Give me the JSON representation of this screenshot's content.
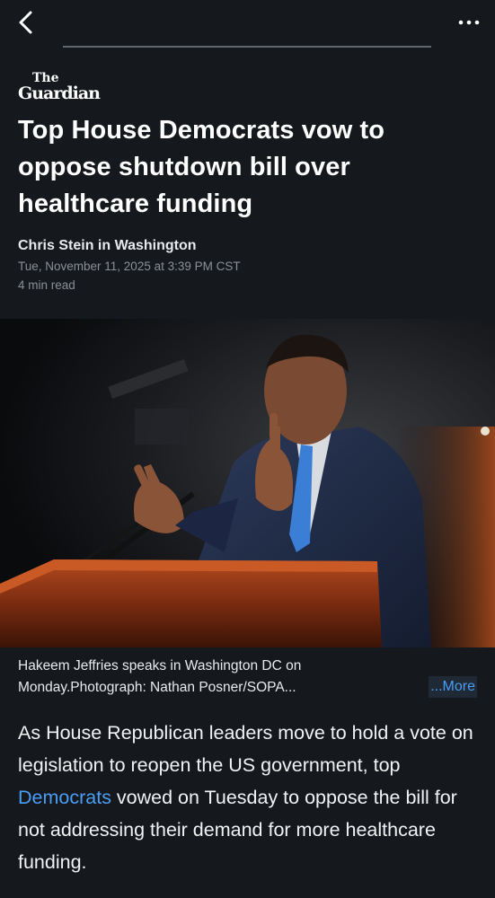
{
  "topbar": {
    "back_icon": "chevron-left-icon",
    "more_icon": "ellipsis-icon"
  },
  "publisher": {
    "logo_line1": "The",
    "logo_line2": "Guardian"
  },
  "article": {
    "headline": "Top House Democrats vow to oppose shutdown bill over healthcare funding",
    "byline": "Chris Stein in Washington",
    "date": "Tue, November 11, 2025 at 3:39 PM CST",
    "read_time": "4 min read"
  },
  "image": {
    "caption": "Hakeem Jeffries speaks in Washington DC on Monday.Photograph: Nathan Posner/SOPA...",
    "more_label": "...More"
  },
  "body": {
    "before_link": "As House Republican leaders move to hold a vote on legislation to reopen the US government, top ",
    "link_text": "Democrats",
    "after_link": " vowed on Tuesday to oppose the bill for not addressing their demand for more healthcare funding."
  },
  "colors": {
    "background": "#15191d",
    "link": "#4a9df5",
    "muted_text": "#8b9096"
  }
}
